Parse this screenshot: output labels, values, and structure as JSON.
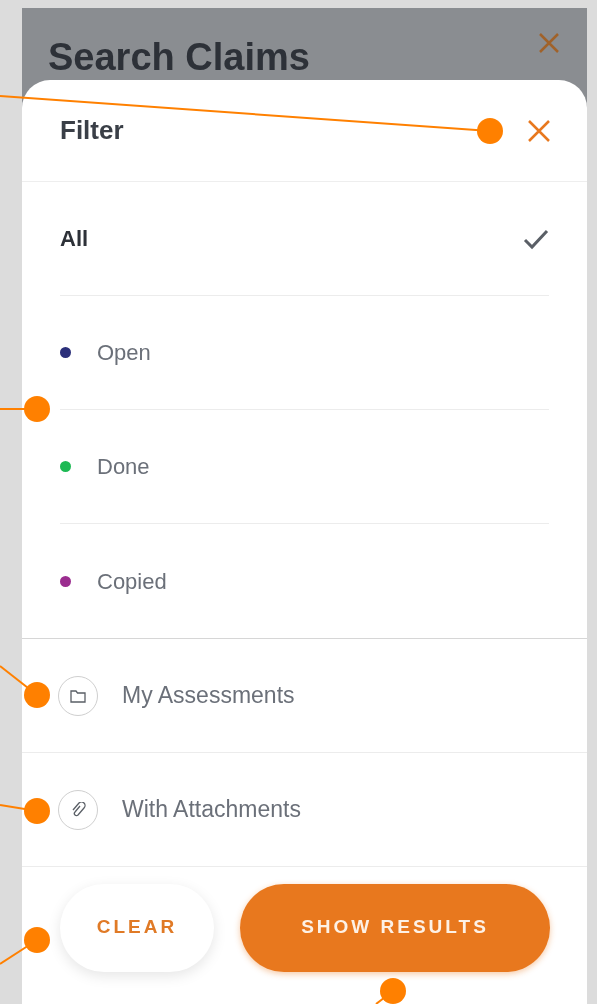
{
  "background_screen": {
    "title": "Search Claims"
  },
  "filter_sheet": {
    "title": "Filter",
    "statuses": [
      {
        "label": "All",
        "selected": true
      },
      {
        "label": "Open",
        "selected": false,
        "color": "#2b2f7a"
      },
      {
        "label": "Done",
        "selected": false,
        "color": "#1db954"
      },
      {
        "label": "Copied",
        "selected": false,
        "color": "#9b2d8f"
      }
    ],
    "options": [
      {
        "label": "My Assessments",
        "kind": "folder"
      },
      {
        "label": "With Attachments",
        "kind": "paperclip"
      }
    ],
    "buttons": [
      {
        "label": "CLEAR",
        "kind": "secondary"
      },
      {
        "label": "SHOW RESULTS",
        "kind": "primary"
      }
    ]
  }
}
